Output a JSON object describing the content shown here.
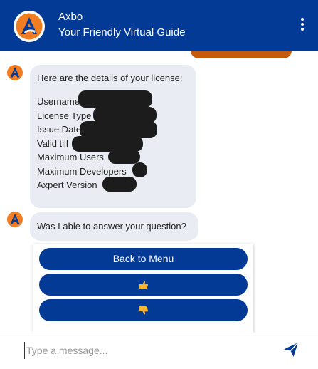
{
  "header": {
    "title": "Axbo",
    "subtitle": "Your Friendly Virtual Guide"
  },
  "messages": {
    "license_intro": "Here are the details of your license:",
    "license_fields": [
      "Username",
      "License Type",
      "Issue Date",
      "Valid till",
      "Maximum Users",
      "Maximum Developers",
      "Axpert Version"
    ],
    "question": "Was I able to answer your question?"
  },
  "quick_replies": {
    "back_to_menu": "Back to Menu",
    "thumbs_up_icon": "thumbs-up-icon",
    "thumbs_down_icon": "thumbs-down-icon"
  },
  "composer": {
    "placeholder": "Type a message..."
  },
  "colors": {
    "brand": "#033a96",
    "bot_bubble": "#e9ecf2",
    "user_bubble": "#c75a07",
    "logo_orange": "#f07d22",
    "thumb": "#f5b830"
  }
}
